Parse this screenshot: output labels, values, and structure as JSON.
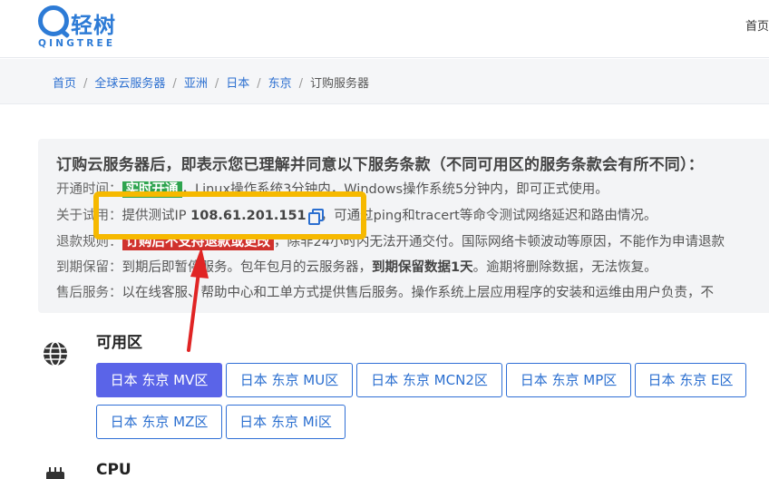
{
  "header": {
    "logo_cn": "轻树",
    "logo_en": "QINGTREE",
    "nav_home": "首页"
  },
  "breadcrumb": [
    {
      "label": "首页",
      "link": true
    },
    {
      "label": "全球云服务器",
      "link": true
    },
    {
      "label": "亚洲",
      "link": true
    },
    {
      "label": "日本",
      "link": true
    },
    {
      "label": "东京",
      "link": true
    },
    {
      "label": "订购服务器",
      "link": false
    }
  ],
  "notice": {
    "title": "订购云服务器后，即表示您已理解并同意以下服务条款（不同可用区的服务条款会有所不同）：",
    "line1": {
      "key": "开通时间：",
      "badge": "实时开通",
      "text": "，Linux操作系统3分钟内，Windows操作系统5分钟内，即可正式使用。"
    },
    "line2": {
      "key": "关于试用：",
      "pre": "提供测试IP ",
      "ip": "108.61.201.151",
      "post": "，可通过ping和tracert等命令测试网络延迟和路由情况。"
    },
    "line3": {
      "key": "退款规则：",
      "badge": "订购后不支持退款或更改",
      "text": "，除非24小时内无法开通交付。国际网络卡顿波动等原因，不能作为申请退款"
    },
    "line4": {
      "key": "到期保留：",
      "pre": "到期后即暂停服务。包年包月的云服务器，",
      "bold": "到期保留数据1天",
      "post": "。逾期将删除数据，无法恢复。"
    },
    "line5": {
      "key": "售后服务：",
      "text": "以在线客服、帮助中心和工单方式提供售后服务。操作系统上层应用程序的安装和运维由用户负责，不"
    }
  },
  "availability": {
    "title": "可用区",
    "zones": [
      {
        "label": "日本 东京 MV区",
        "selected": true
      },
      {
        "label": "日本 东京 MU区",
        "selected": false
      },
      {
        "label": "日本 东京 MCN2区",
        "selected": false
      },
      {
        "label": "日本 东京 MP区",
        "selected": false
      },
      {
        "label": "日本 东京 E区",
        "selected": false
      },
      {
        "label": "日本 东京 MZ区",
        "selected": false
      },
      {
        "label": "日本 东京 Mi区",
        "selected": false
      }
    ]
  },
  "cpu": {
    "title": "CPU"
  },
  "icons": {
    "globe": "globe-icon",
    "cpu": "cpu-chip-icon",
    "copy": "copy-icon"
  },
  "colors": {
    "accent": "#2b6fd0",
    "selected": "#5a64e8",
    "highlight": "#f6b900",
    "arrow": "#e02424",
    "badge_green": "#2ea44f",
    "badge_red": "#d0312d"
  }
}
